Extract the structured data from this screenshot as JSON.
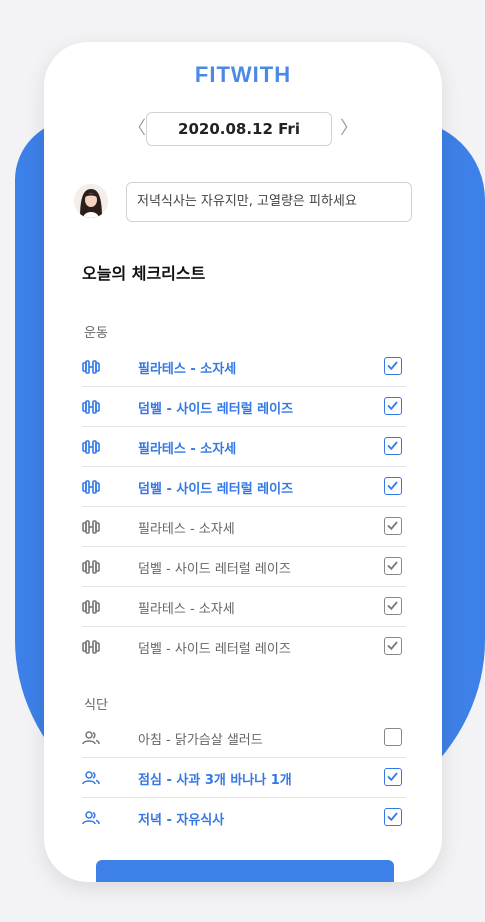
{
  "app": {
    "logo": "FITWITH",
    "accent": "#3d80e8"
  },
  "date": {
    "value": "2020.08.12 Fri",
    "prev_icon": "chevron-left-icon",
    "next_icon": "chevron-right-icon"
  },
  "memo": {
    "text": "저녁식사는 자유지만, 고열량은 피하세요"
  },
  "checklist": {
    "title": "오늘의 체크리스트"
  },
  "exercise": {
    "label": "운동",
    "items": [
      {
        "text": "필라테스 - 소자세",
        "checked": true,
        "active": true
      },
      {
        "text": "덤벨 - 사이드 레터럴 레이즈",
        "checked": true,
        "active": true
      },
      {
        "text": "필라테스 - 소자세",
        "checked": true,
        "active": true
      },
      {
        "text": "덤벨 - 사이드 레터럴 레이즈",
        "checked": true,
        "active": true
      },
      {
        "text": "필라테스 - 소자세",
        "checked": true,
        "active": false
      },
      {
        "text": "덤벨 - 사이드 레터럴 레이즈",
        "checked": true,
        "active": false
      },
      {
        "text": "필라테스 - 소자세",
        "checked": true,
        "active": false
      },
      {
        "text": "덤벨 - 사이드 레터럴 레이즈",
        "checked": true,
        "active": false
      }
    ]
  },
  "diet": {
    "label": "식단",
    "items": [
      {
        "text": "아침 - 닭가슴살 샐러드",
        "checked": false,
        "active": false
      },
      {
        "text": "점심 - 사과 3개 바나나 1개",
        "checked": true,
        "active": true
      },
      {
        "text": "저녁 - 자유식사",
        "checked": true,
        "active": true
      }
    ]
  }
}
